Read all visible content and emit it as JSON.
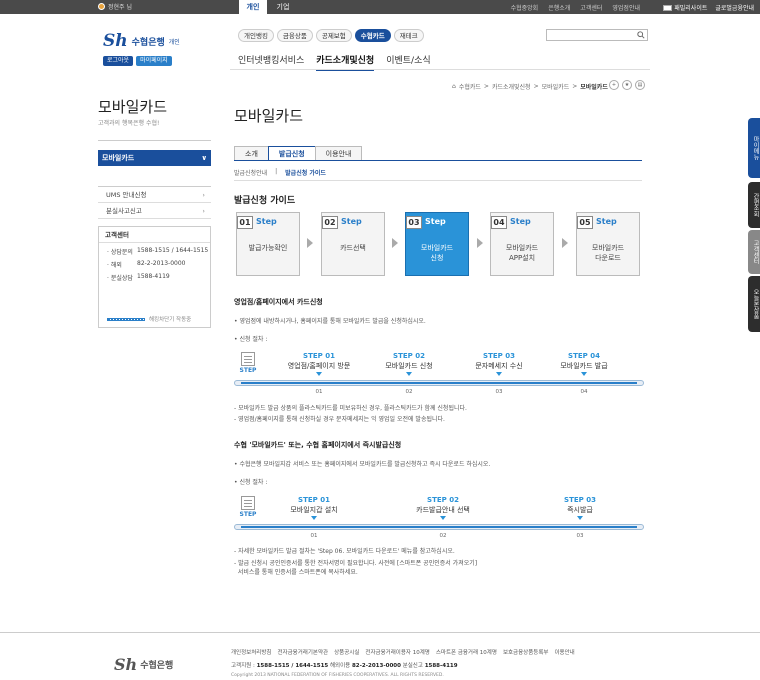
{
  "topbar": {
    "user": "정현주 님",
    "tab_personal": "개인",
    "tab_corporate": "기업",
    "links": [
      "수협중앙회",
      "은행소개",
      "고객센터",
      "영업점안내"
    ],
    "family_site": "패밀리사이트",
    "global": "글로벌금융안내"
  },
  "brand": {
    "mark": "Sh",
    "name": "수협은행",
    "sub": "개인",
    "login": "로그아웃",
    "mypage": "마이페이지"
  },
  "mainnav": [
    "개인뱅킹",
    "금융상품",
    "공제보험",
    "수협카드",
    "재테크"
  ],
  "subnav": [
    "인터넷뱅킹서비스",
    "카드소개및신청",
    "이벤트/소식"
  ],
  "breadcrumb": [
    "수협카드",
    "카드소개및신청",
    "모바일카드",
    "모바일카드"
  ],
  "sidebar": {
    "title": "모바일카드",
    "subtitle": "고객과의 행복은행 수협!",
    "active": "모바일카드",
    "items": [
      "UMS 안내신청",
      "분실사고신고"
    ],
    "cs_title": "고객센터",
    "cs_rows": [
      {
        "label": "· 상담문의",
        "value": "1588-1515 / 1644-1515"
      },
      {
        "label": "· 해외",
        "value": "82-2-2013-0000"
      },
      {
        "label": "· 분실상담",
        "value": "1588-4119"
      }
    ],
    "status": "해킹차단기 작동중"
  },
  "content": {
    "title": "모바일카드",
    "tabs": [
      "소개",
      "발급신청",
      "이용안내"
    ],
    "subtabs": [
      "발급신청안내",
      "발급신청 가이드"
    ],
    "guide_title": "발급신청 가이드",
    "guide_steps": [
      {
        "num": "01",
        "word": "Step",
        "label": "발급가능확인"
      },
      {
        "num": "02",
        "word": "Step",
        "label": "카드선택"
      },
      {
        "num": "03",
        "word": "Step",
        "label": "모바일카드\n신청"
      },
      {
        "num": "04",
        "word": "Step",
        "label": "모바일카드\nAPP설치"
      },
      {
        "num": "05",
        "word": "Step",
        "label": "모바일카드\n다운로드"
      }
    ],
    "section1": {
      "title": "영업점/홈페이지에서 카드신청",
      "bullet1": "• 영업점에 내방하시거나, 홈페이지를 통해 모바일카드 발급을 신청하십시오.",
      "bullet2": "• 신청 절차 :",
      "steps": [
        {
          "h": "STEP 01",
          "d": "영업점/홈페이지 방문",
          "n": "01"
        },
        {
          "h": "STEP 02",
          "d": "모바일카드 신청",
          "n": "02"
        },
        {
          "h": "STEP 03",
          "d": "문자메세지 수신",
          "n": "03"
        },
        {
          "h": "STEP 04",
          "d": "모바일카드 발급",
          "n": "04"
        }
      ],
      "note1": "- 모바일카드 발급 상품의 플라스틱카드를 미보유하신 경우, 플라스틱카드가 함께 신청됩니다.",
      "note2": "- 영업점/홈페이지를 통해 신청하실 경우 문자메세지는 익 영업일 오전에 발송됩니다."
    },
    "section2": {
      "title": "수협 '모바일카드' 또는, 수협 홈페이지에서 즉시발급신청",
      "bullet1": "• 수협은행 모바일지갑 서비스 또는 홈페이지에서 모바일카드를 발급신청하고 즉시 다운로드 하십시오.",
      "bullet2": "• 신청 절차 :",
      "steps": [
        {
          "h": "STEP 01",
          "d": "모바일지갑 설치",
          "n": "01"
        },
        {
          "h": "STEP 02",
          "d": "카드발급안내 선택",
          "n": "02"
        },
        {
          "h": "STEP 03",
          "d": "즉시발급",
          "n": "03"
        }
      ],
      "note1": "- 자세한 모바일카드 발급 절차는 'Step 06. 모바일카드 다운로드' 메뉴를 참고하십시오.",
      "note2": "- 발급 신청시 공인인증서를 통한 전자서명이 필요합니다. 사전에 [스마트폰 공인인증서 가져오기]",
      "note3": "  서비스를 통해 인증서를 스마트폰에 복사하세요.",
      "step_word": "STEP"
    }
  },
  "quicktabs": [
    "마이메뉴",
    "간편조회",
    "고객센터",
    "오늘본상품"
  ],
  "footer": {
    "mark": "Sh",
    "name": "수협은행",
    "links": [
      "개인정보처리방침",
      "전자금융거래기본약관",
      "상품공시실",
      "전자금융거래이용자 10계명",
      "스마트폰 금융거래 10계명",
      "보호금융상품등록부",
      "이용안내"
    ],
    "phones_label1": "고객지원 :",
    "phones_value1": "1588-1515 / 1644-1515",
    "phones_label2": "해외이용",
    "phones_value2": "82-2-2013-0000",
    "phones_label3": "분실신고",
    "phones_value3": "1588-4119",
    "copyright": "Copyright 2013 NATIONAL FEDERATION OF FISHERIES COOPERATIVES. ALL RIGHTS RESERVED."
  }
}
